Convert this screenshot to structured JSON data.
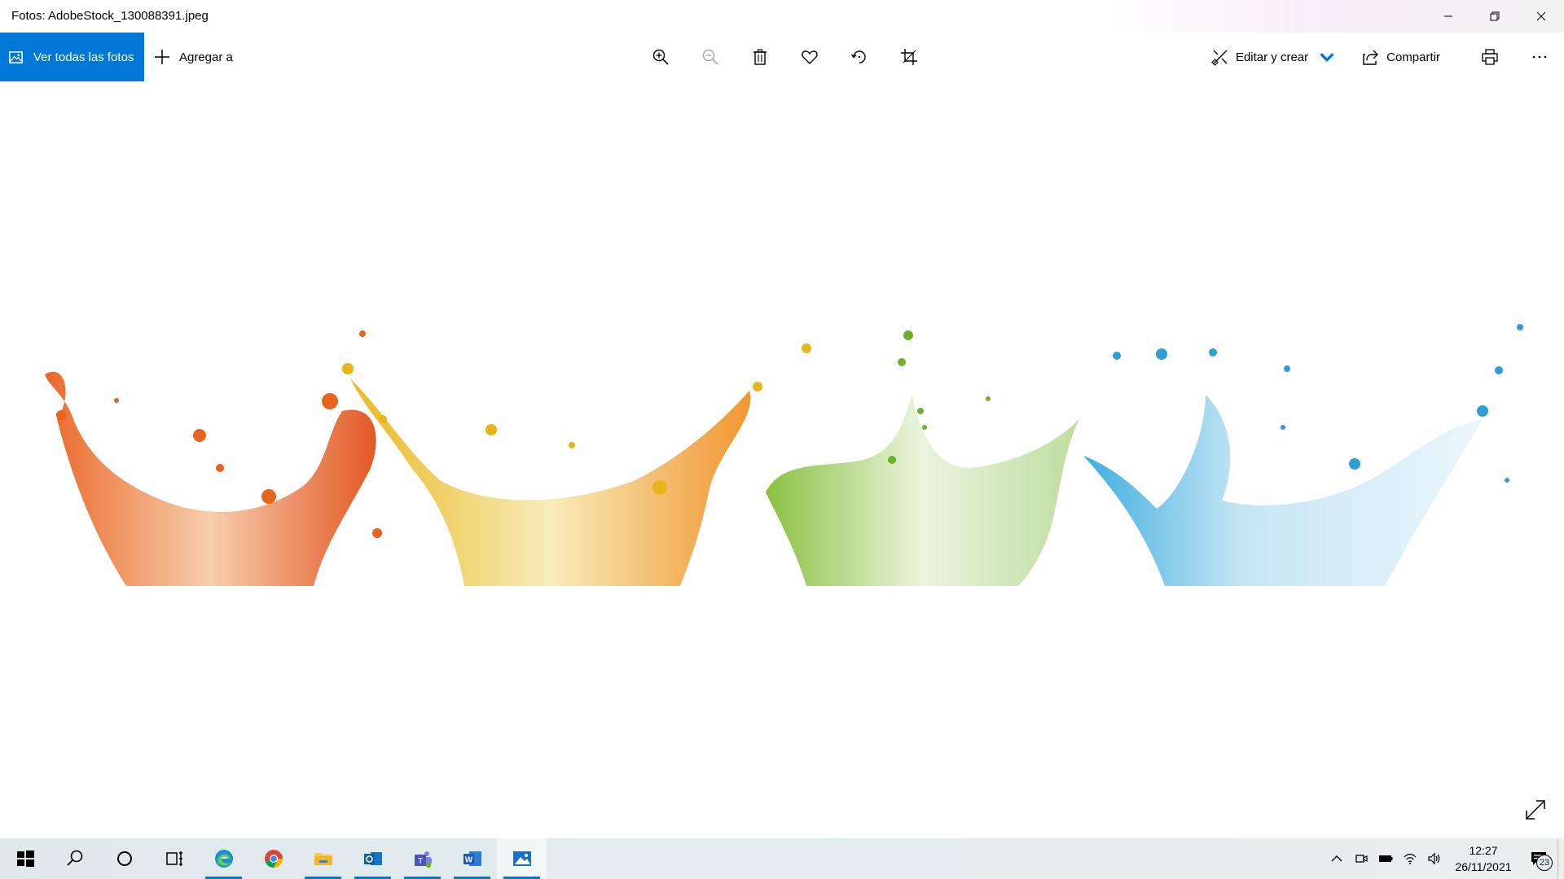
{
  "window": {
    "title": "Fotos: AdobeStock_130088391.jpeg",
    "controls": [
      "minimize-icon",
      "restore-icon",
      "close-icon"
    ]
  },
  "toolbar": {
    "view_all_label": "Ver todas las fotos",
    "add_label": "Agregar a",
    "center_tools": [
      "zoom-in-icon",
      "zoom-out-icon",
      "delete-icon",
      "favorite-icon",
      "rotate-icon",
      "crop-icon"
    ],
    "edit_label": "Editar y crear",
    "share_label": "Compartir",
    "accent_color": "#0078d7"
  },
  "photo": {
    "splash_colors": [
      "#e85b16",
      "#f2c21a",
      "#86c232",
      "#2aa5dc"
    ]
  },
  "taskbar": {
    "apps": [
      "windows-start-icon",
      "search-icon",
      "cortana-icon",
      "task-view-icon",
      "edge-icon",
      "chrome-icon",
      "file-explorer-icon",
      "outlook-icon",
      "teams-icon",
      "word-icon",
      "photos-icon"
    ],
    "time": "12:27",
    "date": "26/11/2021",
    "notification_count": "23"
  }
}
